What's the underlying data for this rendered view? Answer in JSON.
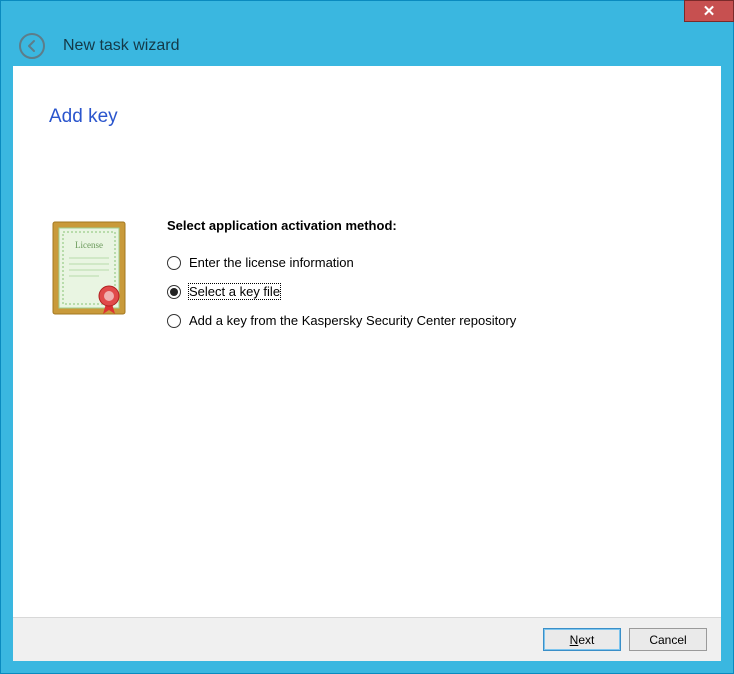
{
  "window": {
    "title": "New task wizard"
  },
  "page": {
    "heading": "Add key",
    "prompt": "Select application activation method:"
  },
  "options": {
    "enter_license": "Enter the license information",
    "select_key_file": "Select a key file",
    "add_from_repo": "Add a key from the Kaspersky Security Center repository",
    "selected": "select_key_file"
  },
  "buttons": {
    "next": "Next",
    "cancel": "Cancel",
    "close": "✕",
    "back_aria": "Back"
  }
}
